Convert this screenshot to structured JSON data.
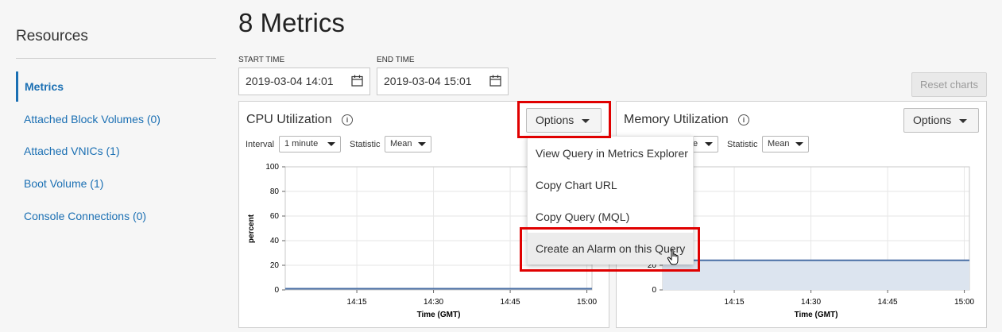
{
  "sidebar": {
    "title": "Resources",
    "items": [
      {
        "label": "Metrics",
        "active": true
      },
      {
        "label": "Attached Block Volumes (0)"
      },
      {
        "label": "Attached VNICs (1)"
      },
      {
        "label": "Boot Volume (1)"
      },
      {
        "label": "Console Connections (0)"
      }
    ]
  },
  "header": {
    "title": "8 Metrics",
    "start_label": "START TIME",
    "start_value": "2019-03-04 14:01",
    "end_label": "END TIME",
    "end_value": "2019-03-04 15:01",
    "reset_label": "Reset charts"
  },
  "cpu": {
    "title": "CPU Utilization",
    "options_label": "Options",
    "interval_label": "Interval",
    "interval_value": "1 minute",
    "statistic_label": "Statistic",
    "statistic_value": "Mean",
    "ylabel": "percent",
    "xlabel": "Time (GMT)"
  },
  "memory": {
    "title": "Memory Utilization",
    "options_label": "Options",
    "interval_value_fragment": "e",
    "statistic_label": "Statistic",
    "statistic_value": "Mean",
    "xlabel": "Time (GMT)"
  },
  "options_menu": {
    "items": [
      "View Query in Metrics Explorer",
      "Copy Chart URL",
      "Copy Query (MQL)",
      "Create an Alarm on this Query"
    ]
  },
  "chart_data": [
    {
      "type": "line",
      "title": "CPU Utilization",
      "xlabel": "Time (GMT)",
      "ylabel": "percent",
      "ylim": [
        0,
        100
      ],
      "yticks": [
        0,
        20,
        40,
        60,
        80,
        100
      ],
      "xticks": [
        "14:15",
        "14:30",
        "14:45",
        "15:00"
      ],
      "series": [
        {
          "x": [
            "14:01",
            "15:01"
          ],
          "values": [
            1,
            1
          ]
        }
      ],
      "grid": true
    },
    {
      "type": "area",
      "title": "Memory Utilization",
      "xlabel": "Time (GMT)",
      "yticks": [
        0,
        20
      ],
      "xticks": [
        "14:15",
        "14:30",
        "14:45",
        "15:00"
      ],
      "series": [
        {
          "x": [
            "14:01",
            "15:01"
          ],
          "values": [
            24,
            24
          ]
        }
      ],
      "grid": true
    }
  ],
  "colors": {
    "accent": "#1a6fb3",
    "highlight": "#e00000",
    "series": "#4a6fa5",
    "area_fill": "#dce4ef"
  }
}
